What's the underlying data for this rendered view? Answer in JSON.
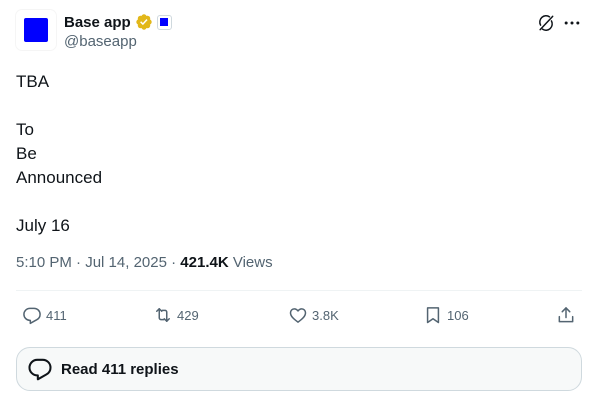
{
  "author": {
    "display_name": "Base app",
    "handle": "@baseapp"
  },
  "tweet": {
    "lines": [
      "TBA",
      "",
      "To",
      "Be",
      "Announced",
      "",
      "July 16"
    ]
  },
  "meta": {
    "time": "5:10 PM",
    "separator1": " · ",
    "date": "Jul 14, 2025",
    "separator2": " · ",
    "views_count": "421.4K",
    "views_label": " Views"
  },
  "actions": {
    "replies": "411",
    "reposts": "429",
    "likes": "3.8K",
    "bookmarks": "106"
  },
  "read_replies": {
    "label": "Read 411 replies"
  },
  "icons": {
    "verified": "verified-gold-badge-icon",
    "affiliate": "affiliate-badge-icon",
    "grok": "grok-icon",
    "more": "more-icon",
    "reply": "reply-icon",
    "repost": "repost-icon",
    "like": "heart-icon",
    "bookmark": "bookmark-icon",
    "share": "share-icon"
  },
  "colors": {
    "avatar_square": "#0000ff",
    "verified_gold": "#e2b719",
    "text_primary": "#0f1419",
    "text_secondary": "#536471"
  }
}
